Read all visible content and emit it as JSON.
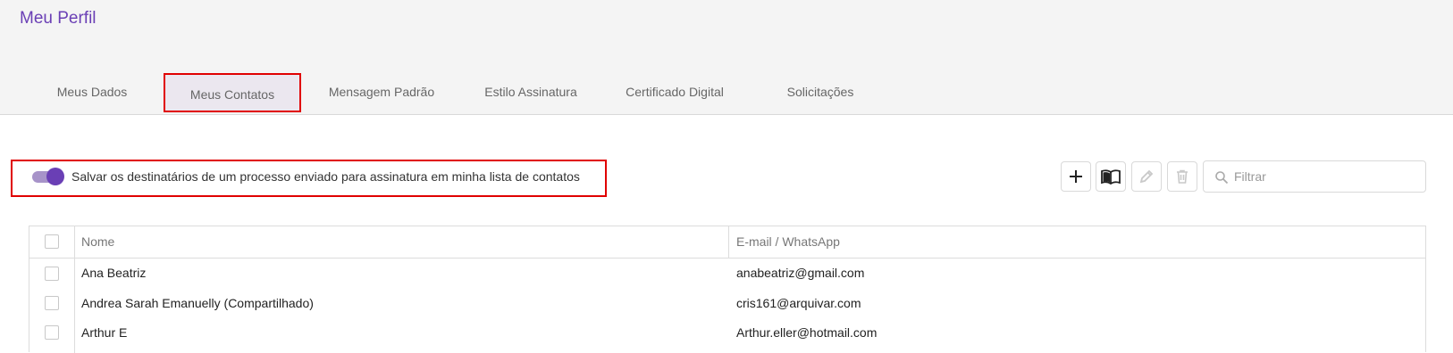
{
  "page": {
    "title": "Meu Perfil"
  },
  "tabs": [
    {
      "label": "Meus Dados"
    },
    {
      "label": "Meus Contatos"
    },
    {
      "label": "Mensagem Padrão"
    },
    {
      "label": "Estilo Assinatura"
    },
    {
      "label": "Certificado Digital"
    },
    {
      "label": "Solicitações"
    }
  ],
  "active_tab": "Meus Contatos",
  "option": {
    "label": "Salvar os destinatários de um processo enviado para assinatura em minha lista de contatos",
    "enabled": true
  },
  "toolbar": {
    "add_icon": "plus-icon",
    "book_icon": "book-icon",
    "edit_icon": "pencil-icon",
    "delete_icon": "trash-icon",
    "filter_placeholder": "Filtrar",
    "filter_icon": "search-icon"
  },
  "table": {
    "headers": {
      "name": "Nome",
      "email": "E-mail / WhatsApp"
    },
    "rows": [
      {
        "name": "Ana Beatriz",
        "email": "anabeatriz@gmail.com"
      },
      {
        "name": "Andrea Sarah Emanuelly (Compartilhado)",
        "email": "cris161@arquivar.com"
      },
      {
        "name": "Arthur E",
        "email": "Arthur.eller@hotmail.com"
      }
    ]
  },
  "colors": {
    "accent": "#6a3fb5",
    "highlight_border": "#e00000"
  }
}
